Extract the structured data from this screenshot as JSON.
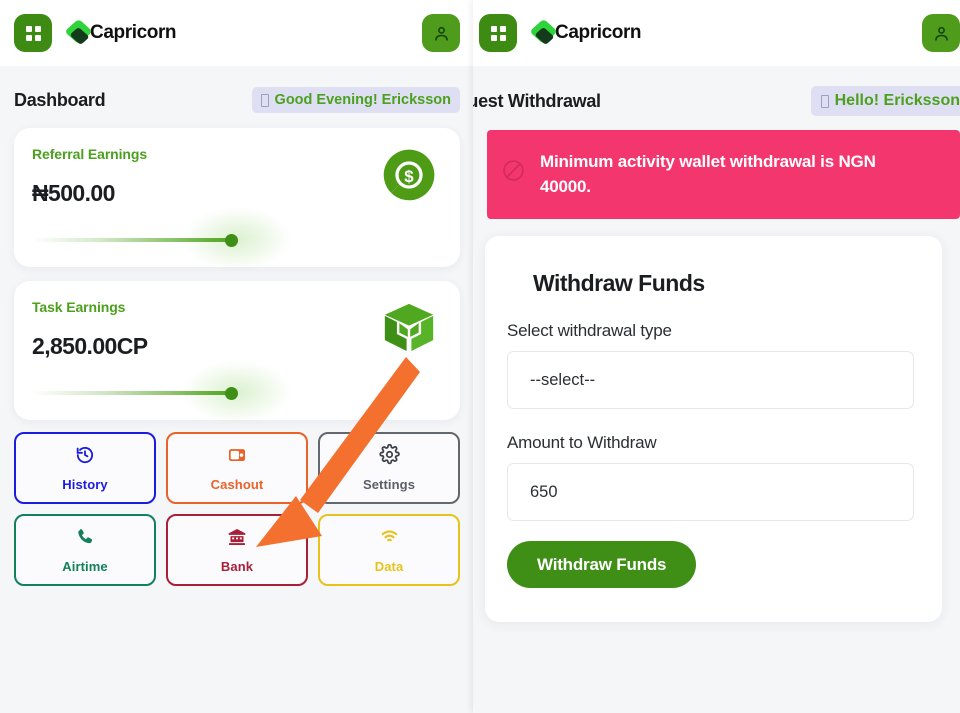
{
  "colors": {
    "brand_green": "#3d8b12",
    "accent_green": "#4ca01e",
    "alert_pink": "#f4366e",
    "badge_lavender": "#dedff3",
    "history_blue": "#1c1ce0",
    "cashout_orange": "#e8622a",
    "settings_gray": "#5a5f66",
    "airtime_teal": "#128058",
    "bank_red": "#a81f38",
    "data_yellow": "#e8c21c",
    "annotation_arrow": "#f4702f"
  },
  "left_panel": {
    "appbar": {
      "grid_icon": "grid-menu-icon",
      "brand_mark_icon": "capricorn-logo-icon",
      "brand_name": "Capricorn",
      "avatar_icon": "user-avatar-icon"
    },
    "page_title": "Dashboard",
    "greeting": "Good Evening! Ericksson",
    "cards": [
      {
        "label": "Referral Earnings",
        "amount": "₦500.00",
        "icon": "pie-chart-dollar-icon"
      },
      {
        "label": "Task Earnings",
        "amount": "2,850.00CP",
        "icon": "open-box-package-icon"
      }
    ],
    "actions": [
      {
        "label": "History",
        "icon": "history-clock-icon",
        "color": "#1c1ce0"
      },
      {
        "label": "Cashout",
        "icon": "wallet-icon",
        "color": "#e8622a"
      },
      {
        "label": "Settings",
        "icon": "gear-icon",
        "color": "#5a5f66"
      },
      {
        "label": "Airtime",
        "icon": "phone-call-icon",
        "color": "#128058"
      },
      {
        "label": "Bank",
        "icon": "bank-building-icon",
        "color": "#a81f38"
      },
      {
        "label": "Data",
        "icon": "wifi-icon",
        "color": "#e8c21c"
      }
    ]
  },
  "right_panel": {
    "appbar": {
      "grid_icon": "grid-menu-icon",
      "brand_mark_icon": "capricorn-logo-icon",
      "brand_name": "Capricorn",
      "avatar_icon": "user-avatar-icon"
    },
    "page_title": "equest Withdrawal",
    "greeting": "Hello! Ericksson",
    "alert": {
      "icon": "no-entry-icon",
      "message": "Minimum activity wallet withdrawal is NGN 40000."
    },
    "form": {
      "title": "Withdraw Funds",
      "type_label": "Select withdrawal type",
      "type_value": "--select--",
      "amount_label": "Amount to Withdraw",
      "amount_value": "650",
      "submit_label": "Withdraw Funds"
    }
  },
  "annotation": {
    "arrow_icon": "pointer-arrow-annotation",
    "from": "open-box-package-icon",
    "to": "cashout-button"
  }
}
